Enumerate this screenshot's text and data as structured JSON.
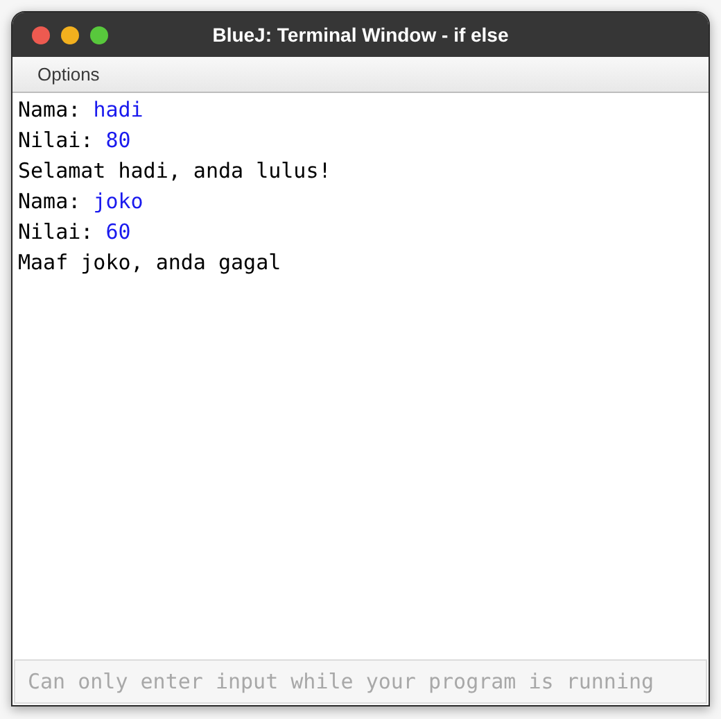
{
  "window": {
    "title": "BlueJ: Terminal Window - if else"
  },
  "menu_bar": {
    "items": [
      "Options"
    ]
  },
  "terminal": {
    "lines": [
      [
        {
          "kind": "output",
          "text": "Nama: "
        },
        {
          "kind": "input",
          "text": "hadi"
        }
      ],
      [
        {
          "kind": "output",
          "text": "Nilai: "
        },
        {
          "kind": "input",
          "text": "80"
        }
      ],
      [
        {
          "kind": "output",
          "text": "Selamat hadi, anda lulus!"
        }
      ],
      [
        {
          "kind": "output",
          "text": "Nama: "
        },
        {
          "kind": "input",
          "text": "joko"
        }
      ],
      [
        {
          "kind": "output",
          "text": "Nilai: "
        },
        {
          "kind": "input",
          "text": "60"
        }
      ],
      [
        {
          "kind": "output",
          "text": "Maaf joko, anda gagal"
        }
      ]
    ]
  },
  "input_field": {
    "placeholder": "Can only enter input while your program is running",
    "disabled": true
  }
}
